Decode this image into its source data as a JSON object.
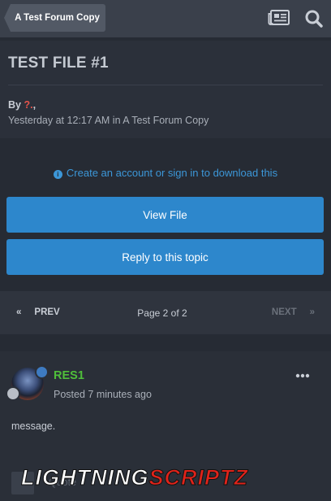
{
  "header": {
    "breadcrumb": "A Test Forum Copy",
    "icons": [
      "activity-icon",
      "search-icon"
    ]
  },
  "file": {
    "title": "TEST FILE #1",
    "by_label": "By",
    "author": "?.",
    "author_suffix": ",",
    "dateline": "Yesterday at 12:17 AM in A Test Forum Copy"
  },
  "download": {
    "signin_text": "Create an account or sign in to download this",
    "view_button": "View File",
    "reply_button": "Reply to this topic"
  },
  "pagination": {
    "prev_label": "PREV",
    "page_info": "Page 2 of 2",
    "next_label": "NEXT"
  },
  "post": {
    "author": "RES1",
    "posted": "Posted 7 minutes ago",
    "message": "message.",
    "quote_label": "Quote"
  },
  "watermark": {
    "text_white": "LIGHTNING",
    "text_red": "SCRIPTZ"
  },
  "colors": {
    "accent_blue": "#2d87cc",
    "link_blue": "#3c97d8",
    "author_red": "#e2534b",
    "poster_green": "#4fbf3a"
  }
}
